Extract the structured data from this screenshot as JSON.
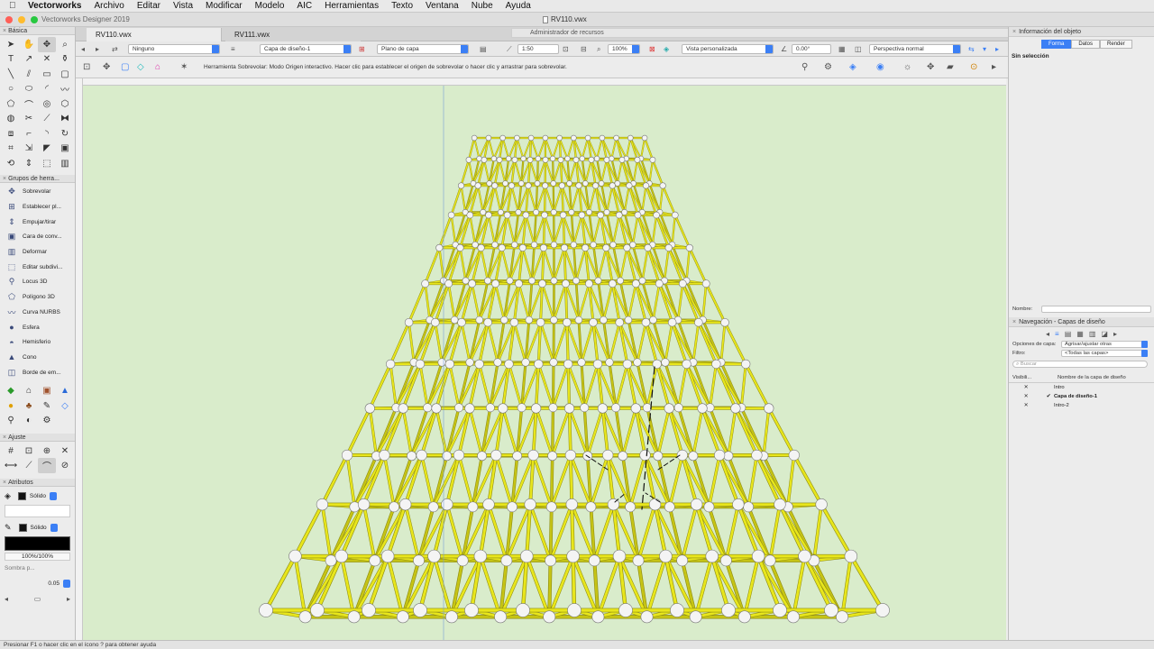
{
  "menubar": {
    "app": "Vectorworks",
    "items": [
      "Archivo",
      "Editar",
      "Vista",
      "Modificar",
      "Modelo",
      "AIC",
      "Herramientas",
      "Texto",
      "Ventana",
      "Nube",
      "Ayuda"
    ]
  },
  "window": {
    "app_title": "Vectorworks Designer 2019",
    "doc_title": "RV110.vwx",
    "traffic_colors": [
      "#ff5f57",
      "#febc2e",
      "#28c840"
    ]
  },
  "tabs": {
    "doc1": "RV110.vwx",
    "doc2": "RV111.vwx",
    "resource_manager": "Administrador de recursos"
  },
  "left": {
    "basic_title": "Básica",
    "basic_tools": [
      "arrow-tool",
      "pan-tool",
      "flyover-tool",
      "zoom-tool",
      "text-tool",
      "callout-tool",
      "dimension-tool",
      "eyedropper-tool",
      "line-tool",
      "double-line-tool",
      "rectangle-tool",
      "rounded-rect-tool",
      "circle-tool",
      "ellipse-tool",
      "arc-tool",
      "freehand-tool",
      "polygon-tool",
      "polyline-tool",
      "spiral-tool",
      "regular-polygon-tool",
      "offset-tool",
      "trim-tool",
      "split-tool",
      "mirror-tool",
      "clip-tool",
      "connect-tool",
      "fillet-tool",
      "rotate-tool",
      "reshape-tool",
      "move-tool",
      "chamfer-tool",
      "extrude-tool",
      "attribute-mapping-tool",
      "push-pull-tool",
      "subdivision-tool",
      "deform-tool"
    ],
    "toolsets_title": "Grupos de herra...",
    "toolset_items": [
      {
        "label": "Sobrevolar",
        "icon": "flyover-icon"
      },
      {
        "label": "Establecer pl...",
        "icon": "set-plane-icon"
      },
      {
        "label": "Empujar/tirar",
        "icon": "push-pull-icon"
      },
      {
        "label": "Cara de conv...",
        "icon": "face-icon"
      },
      {
        "label": "Deformar",
        "icon": "deform-icon"
      },
      {
        "label": "Editar subdivi...",
        "icon": "subdivision-icon"
      },
      {
        "label": "Locus 3D",
        "icon": "locus-icon"
      },
      {
        "label": "Polígono 3D",
        "icon": "polygon-3d-icon"
      },
      {
        "label": "Curva NURBS",
        "icon": "nurbs-icon"
      },
      {
        "label": "Esfera",
        "icon": "sphere-icon"
      },
      {
        "label": "Hemisferio",
        "icon": "hemisphere-icon"
      },
      {
        "label": "Cono",
        "icon": "cone-icon"
      },
      {
        "label": "Borde de em...",
        "icon": "edge-icon"
      }
    ],
    "snap_title": "Ajuste",
    "attributes_title": "Atributos",
    "fill_style": "Sólido",
    "pen_style": "Sólido",
    "opacity": "100%/100%",
    "shadow_label": "Sombra p...",
    "line_thickness": "0.05"
  },
  "viewbar": {
    "class": "Ninguno",
    "layer": "Capa de diseño-1",
    "plane": "Plano de capa",
    "scale": "1:50",
    "zoom": "100%",
    "view": "Vista personalizada",
    "rotation": "0.00°",
    "render": "Perspectiva normal"
  },
  "toolbar": {
    "hint": "Herramienta Sobrevolar: Modo Origen interactivo. Hacer clic para establecer el origen de sobrevolar o hacer clic y arrastrar para sobrevolar."
  },
  "statusbar": {
    "text": "Presionar F1 o hacer clic en el ícono ? para obtener ayuda"
  },
  "right": {
    "obj_info_title": "Información del objeto",
    "tab_shape": "Forma",
    "tab_data": "Datos",
    "tab_render": "Render",
    "no_selection": "Sin selección",
    "name_label": "Nombre:",
    "nav_title": "Navegación - Capas de diseño",
    "layer_options_label": "Opciones de capa:",
    "layer_options_value": "Agrisar/ajustar otras",
    "filter_label": "Filtro:",
    "filter_value": "<Todas las capas>",
    "search_placeholder": "Buscar",
    "col_visibility": "Visibili...",
    "col_name": "Nombre de la capa de diseño",
    "layers": [
      {
        "name": "Intro",
        "active": false
      },
      {
        "name": "Capa de diseño-1",
        "active": true
      },
      {
        "name": "Intro-2",
        "active": false
      }
    ]
  },
  "colors": {
    "canvas_bg": "#d9eccb",
    "truss_yellow": "#e8e61c",
    "accent_blue": "#3b7ff5"
  }
}
